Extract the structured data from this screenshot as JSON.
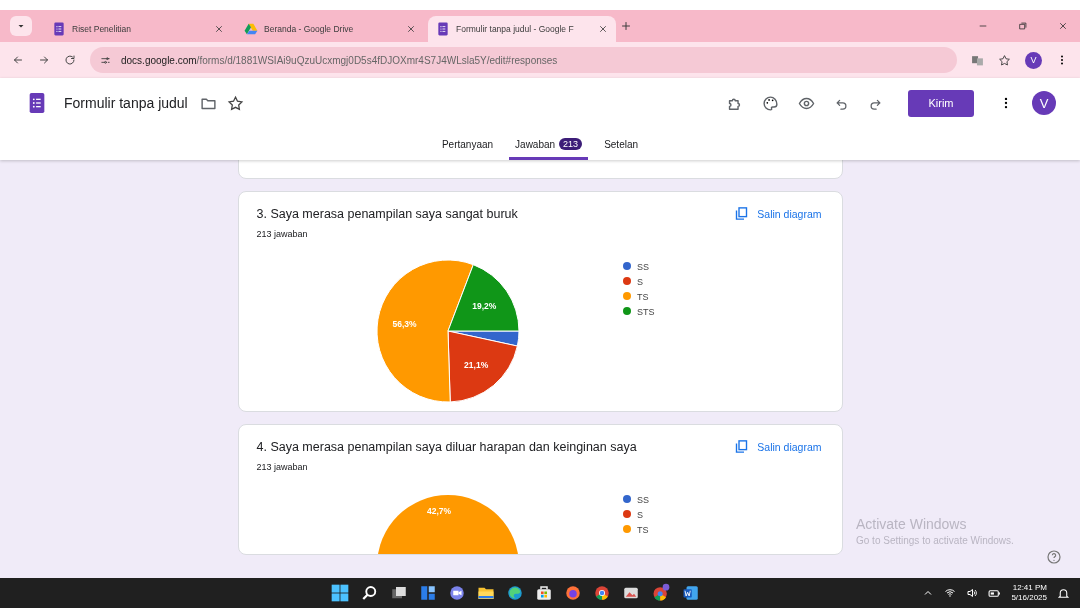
{
  "browser": {
    "tabs": [
      {
        "title": "Riset Penelitian",
        "kind": "form",
        "selected": false
      },
      {
        "title": "Beranda - Google Drive",
        "kind": "drive",
        "selected": false
      },
      {
        "title": "Formulir tanpa judul - Google F",
        "kind": "form",
        "selected": true
      }
    ],
    "url_host": "docs.google.com",
    "url_path": "/forms/d/1881WSIAi9uQzuUcxmgj0D5s4fDJOXmr4S7J4WLsla5Y/edit#responses",
    "profile_initial": "V"
  },
  "app": {
    "title": "Formulir tanpa judul",
    "send_button": "Kirim",
    "avatar_initial": "V",
    "tabs": [
      {
        "label": "Pertanyaan",
        "selected": false
      },
      {
        "label": "Jawaban",
        "badge": "213",
        "selected": true
      },
      {
        "label": "Setelan",
        "selected": false
      }
    ]
  },
  "questions": [
    {
      "kind": "chart",
      "title": "3. Saya merasa penampilan saya sangat buruk",
      "count": "213 jawaban",
      "copy_button": "Salin diagram",
      "chart_data": {
        "type": "pie",
        "categories": [
          "SS",
          "S",
          "TS",
          "STS"
        ],
        "colors": [
          "#3366cc",
          "#dc3912",
          "#ff9900",
          "#109618"
        ],
        "values": [
          3.4,
          21.1,
          56.3,
          19.2
        ],
        "value_labels": [
          null,
          "21,1%",
          "56,3%",
          "19,2%"
        ]
      }
    },
    {
      "kind": "partial",
      "title": "4. Saya merasa penampilan saya diluar harapan dan keinginan saya",
      "count": "213 jawaban",
      "copy_button": "Salin diagram",
      "legend": [
        {
          "label": "SS",
          "color": "#3366cc"
        },
        {
          "label": "S",
          "color": "#dc3912"
        },
        {
          "label": "TS",
          "color": "#ff9900"
        }
      ],
      "slice_label": "42,7%"
    }
  ],
  "activation_notice": {
    "title": "Activate Windows",
    "subtitle": "Go to Settings to activate Windows."
  },
  "taskbar": {
    "time": "12:41 PM",
    "date": "5/16/2025"
  }
}
